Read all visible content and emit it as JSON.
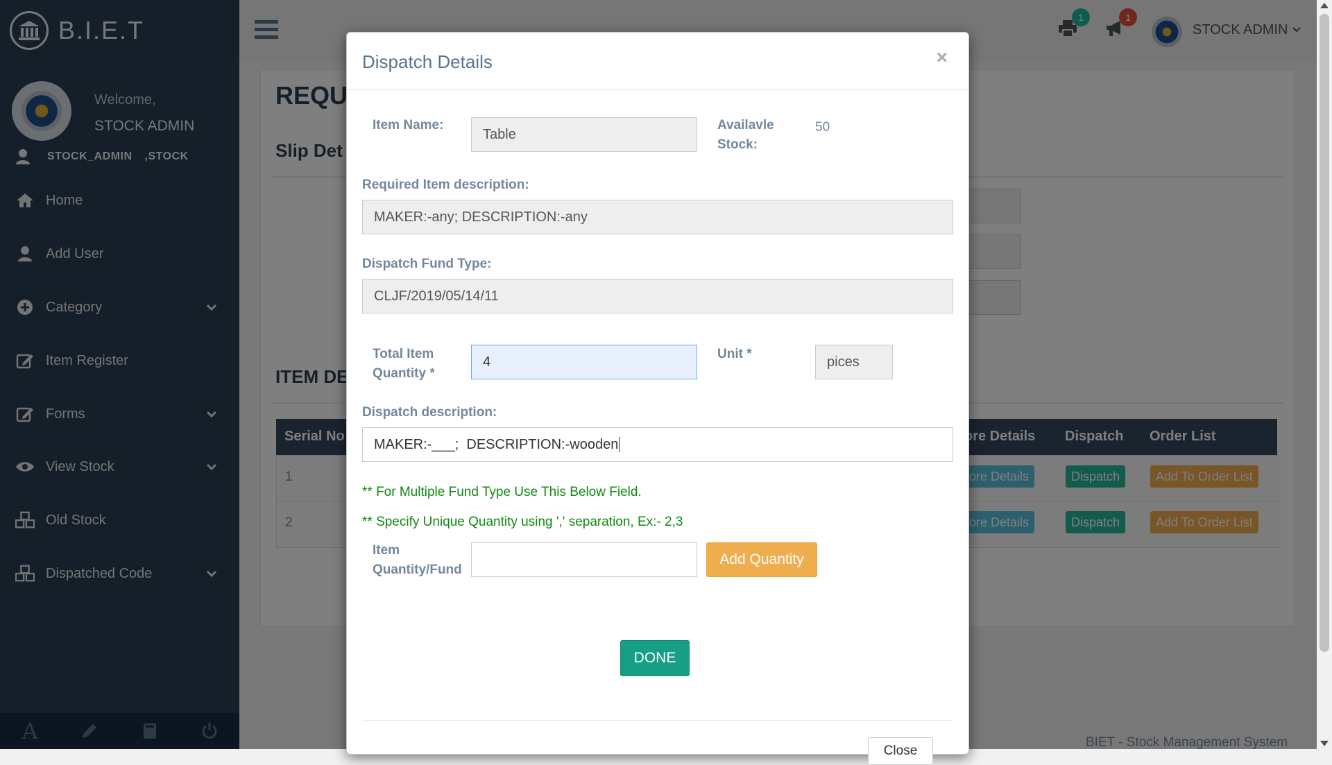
{
  "brand": {
    "name": "B.I.E.T"
  },
  "profile": {
    "welcome": "Welcome,",
    "name": "STOCK ADMIN",
    "role": "STOCK_ADMIN",
    "dept": ",STOCK"
  },
  "sidebar": {
    "items": [
      {
        "label": "Home",
        "icon": "home-icon"
      },
      {
        "label": "Add User",
        "icon": "user-icon"
      },
      {
        "label": "Category",
        "icon": "plus-circle-icon"
      },
      {
        "label": "Item Register",
        "icon": "edit-icon"
      },
      {
        "label": "Forms",
        "icon": "edit-icon"
      },
      {
        "label": "View Stock",
        "icon": "eye-icon"
      },
      {
        "label": "Old Stock",
        "icon": "cubes-icon"
      },
      {
        "label": "Dispatched Code",
        "icon": "cubes-icon"
      }
    ],
    "footer_icons": [
      "font-icon",
      "pencil-icon",
      "book-icon",
      "power-icon"
    ]
  },
  "topnav": {
    "print_badge": "1",
    "notify_badge": "1",
    "user_label": "STOCK ADMIN",
    "badge_colors": {
      "print": "#1abb9c",
      "notify": "#e74c3c"
    }
  },
  "page": {
    "title": "REQU",
    "slip_title": "Slip Det",
    "item_title": "ITEM DE",
    "table_headers": {
      "serial": "Serial No",
      "more": "ore Details",
      "dispatch": "Dispatch",
      "order": "Order List"
    },
    "rows": [
      {
        "serial": "1",
        "more": "ore Details",
        "dispatch": "Dispatch",
        "order": "Add To Order List"
      },
      {
        "serial": "2",
        "more": "ore Details",
        "dispatch": "Dispatch",
        "order": "Add To Order List"
      }
    ],
    "footer": "BIET - Stock Management System"
  },
  "modal": {
    "title": "Dispatch Details",
    "close": "×",
    "item_name_label": "Item Name:",
    "item_name_value": "Table",
    "available_label_1": "Availavle",
    "available_label_2": "Stock:",
    "available_value": "50",
    "req_desc_label": "Required Item description:",
    "req_desc_value": "MAKER:-any; DESCRIPTION:-any",
    "fund_type_label": "Dispatch Fund Type:",
    "fund_type_value": "CLJF/2019/05/14/11",
    "total_qty_label_1": "Total Item",
    "total_qty_label_2": "Quantity *",
    "total_qty_value": "4",
    "unit_label": "Unit *",
    "unit_value": "pices",
    "dispatch_desc_label": "Dispatch description:",
    "dispatch_desc_value": "MAKER:-___;  DESCRIPTION:-wooden",
    "note_1": "** For Multiple Fund Type Use This Below Field.",
    "note_2": "** Specify Unique Quantity using ',' separation, Ex:- 2,3",
    "qty_fund_label_1": "Item",
    "qty_fund_label_2": "Quantity/Fund",
    "qty_fund_value": "",
    "add_quantity": "Add Quantity",
    "done": "DONE",
    "close_button": "Close"
  }
}
